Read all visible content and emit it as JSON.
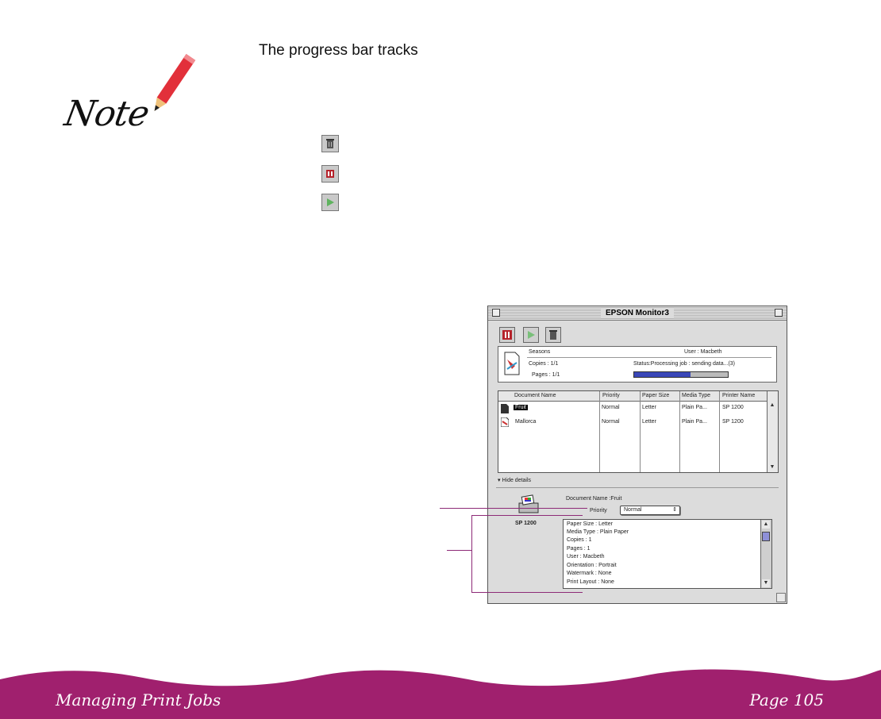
{
  "note": {
    "label": "Note"
  },
  "intro_text": "The progress bar tracks",
  "icons": [
    {
      "name": "trash-icon"
    },
    {
      "name": "pause-icon"
    },
    {
      "name": "resume-icon"
    }
  ],
  "window": {
    "title": "EPSON Monitor3",
    "job": {
      "name": "Seasons",
      "user": "User : Macbeth",
      "copies": "Copies : 1/1",
      "status": "Status:Processing job : sending data...(3)",
      "pages": "Pages : 1/1",
      "progress": 0.6
    },
    "table": {
      "columns": [
        "Document Name",
        "Priority",
        "Paper Size",
        "Media Type",
        "Printer Name"
      ],
      "rows": [
        {
          "name": "Fruit",
          "priority": "Normal",
          "paper": "Letter",
          "media": "Plain Pa...",
          "printer": "SP 1200",
          "selected": true
        },
        {
          "name": "Mallorca",
          "priority": "Normal",
          "paper": "Letter",
          "media": "Plain Pa...",
          "printer": "SP 1200",
          "selected": false
        }
      ]
    },
    "hide_details": "Hide details",
    "printer_label": "SP 1200",
    "document_name": "Document Name :Fruit",
    "priority_label": "Priority",
    "priority_value": "Normal",
    "details": [
      "Paper Size : Letter",
      "Media Type : Plain Paper",
      "Copies : 1",
      "Pages : 1",
      "User : Macbeth",
      "Orientation : Portrait",
      "Watermark : None",
      "Print Layout : None"
    ]
  },
  "footer": {
    "left": "Managing Print Jobs",
    "right": "Page 105"
  },
  "colors": {
    "footer": "#a0206e",
    "accent_pen": "#e2303a",
    "progress": "#3a47b8"
  }
}
